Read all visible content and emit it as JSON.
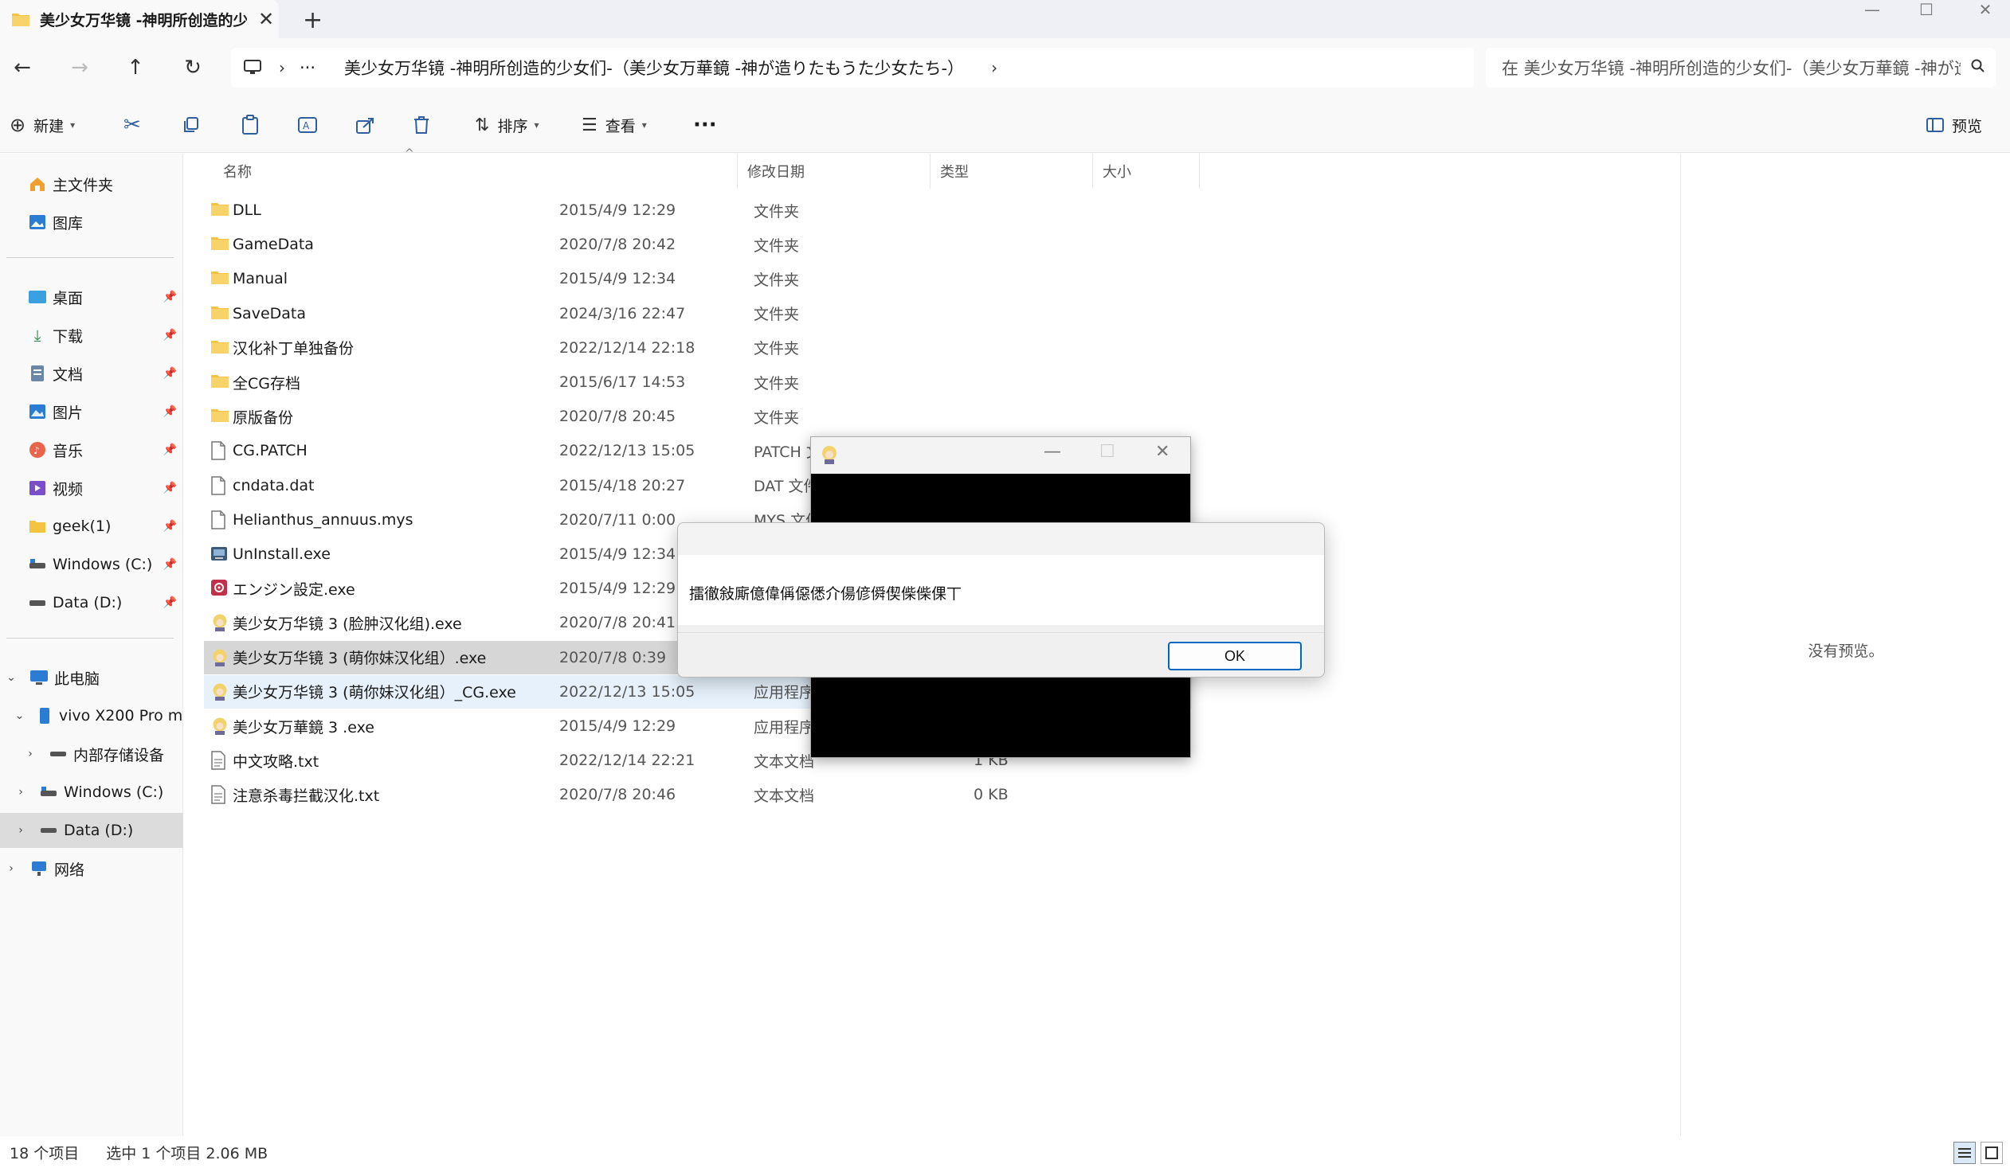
{
  "window": {
    "tab_title": "美少女万华镜 -神明所创造的少",
    "new_tab_symbol": "+",
    "controls": {
      "minimize": "—",
      "maximize": "☐",
      "close": "✕"
    }
  },
  "address": {
    "overflow": "···",
    "path": "美少女万华镜 -神明所创造的少女们-（美少女万華鏡 -神が造りたもうた少女たち-）",
    "search_placeholder": "在 美少女万华镜 -神明所创造的少女们-（美少女万華鏡 -神が造"
  },
  "commands": {
    "new": "新建",
    "sort": "排序",
    "view": "查看",
    "more": "···",
    "preview": "预览"
  },
  "sidebar": {
    "home": "主文件夹",
    "gallery": "图库",
    "desktop": "桌面",
    "downloads": "下载",
    "documents": "文档",
    "pictures": "图片",
    "music": "音乐",
    "videos": "视频",
    "geek": "geek(1)",
    "windows_c": "Windows (C:)",
    "data_d": "Data (D:)",
    "this_pc": "此电脑",
    "phone": "vivo X200 Pro mini",
    "internal": "内部存储设备",
    "pc_windows_c": "Windows (C:)",
    "pc_data_d": "Data (D:)",
    "network": "网络"
  },
  "columns": {
    "name": "名称",
    "date": "修改日期",
    "type": "类型",
    "size": "大小"
  },
  "files": [
    {
      "name": "DLL",
      "date": "2015/4/9 12:29",
      "type": "文件夹",
      "size": "",
      "icon": "folder-icon"
    },
    {
      "name": "GameData",
      "date": "2020/7/8 20:42",
      "type": "文件夹",
      "size": "",
      "icon": "folder-icon"
    },
    {
      "name": "Manual",
      "date": "2015/4/9 12:34",
      "type": "文件夹",
      "size": "",
      "icon": "folder-icon"
    },
    {
      "name": "SaveData",
      "date": "2024/3/16 22:47",
      "type": "文件夹",
      "size": "",
      "icon": "folder-icon"
    },
    {
      "name": "汉化补丁单独备份",
      "date": "2022/12/14 22:18",
      "type": "文件夹",
      "size": "",
      "icon": "folder-icon"
    },
    {
      "name": "全CG存档",
      "date": "2015/6/17 14:53",
      "type": "文件夹",
      "size": "",
      "icon": "folder-icon"
    },
    {
      "name": "原版备份",
      "date": "2020/7/8 20:45",
      "type": "文件夹",
      "size": "",
      "icon": "folder-icon"
    },
    {
      "name": "CG.PATCH",
      "date": "2022/12/13 15:05",
      "type": "PATCH 文",
      "size": "",
      "icon": "file-icon"
    },
    {
      "name": "cndata.dat",
      "date": "2015/4/18 20:27",
      "type": "DAT 文件",
      "size": "",
      "icon": "file-icon"
    },
    {
      "name": "Helianthus_annuus.mys",
      "date": "2020/7/11 0:00",
      "type": "MYS 文件",
      "size": "",
      "icon": "file-icon"
    },
    {
      "name": "UnInstall.exe",
      "date": "2015/4/9 12:34",
      "type": "",
      "size": "",
      "icon": "uninstall-icon"
    },
    {
      "name": "エンジン設定.exe",
      "date": "2015/4/9 12:29",
      "type": "",
      "size": "",
      "icon": "settings-exe-icon"
    },
    {
      "name": "美少女万华镜 3 (脸肿汉化组).exe",
      "date": "2020/7/8 20:41",
      "type": "",
      "size": "",
      "icon": "game-exe-icon"
    },
    {
      "name": "美少女万华镜 3 (萌你妹汉化组）.exe",
      "date": "2020/7/8 0:39",
      "type": "",
      "size": "",
      "icon": "game-exe-icon",
      "selected": true
    },
    {
      "name": "美少女万华镜 3 (萌你妹汉化组）_CG.exe",
      "date": "2022/12/13 15:05",
      "type": "应用程序",
      "size": "",
      "icon": "game-exe-icon",
      "hover": true
    },
    {
      "name": "美少女万華鏡 3 .exe",
      "date": "2015/4/9 12:29",
      "type": "应用程序",
      "size": "",
      "icon": "game-exe-icon"
    },
    {
      "name": "中文攻略.txt",
      "date": "2022/12/14 22:21",
      "type": "文本文档",
      "size": "1 KB",
      "icon": "text-file-icon"
    },
    {
      "name": "注意杀毒拦截汉化.txt",
      "date": "2020/7/8 20:46",
      "type": "文本文档",
      "size": "0 KB",
      "icon": "text-file-icon"
    }
  ],
  "preview": {
    "empty_text": "没有预览。"
  },
  "status": {
    "count": "18 个项目",
    "selected": "选中 1 个项目  2.06 MB"
  },
  "dialog": {
    "message": "擂徹敍廝億偉偁僫僁介偒偐僢偰偨偨倮丅",
    "ok_label": "OK"
  },
  "colors": {
    "accent": "#0067c0",
    "folder": "#f5c342",
    "selected_row": "#d6d6d6",
    "hover_row": "#e6f1fb"
  }
}
